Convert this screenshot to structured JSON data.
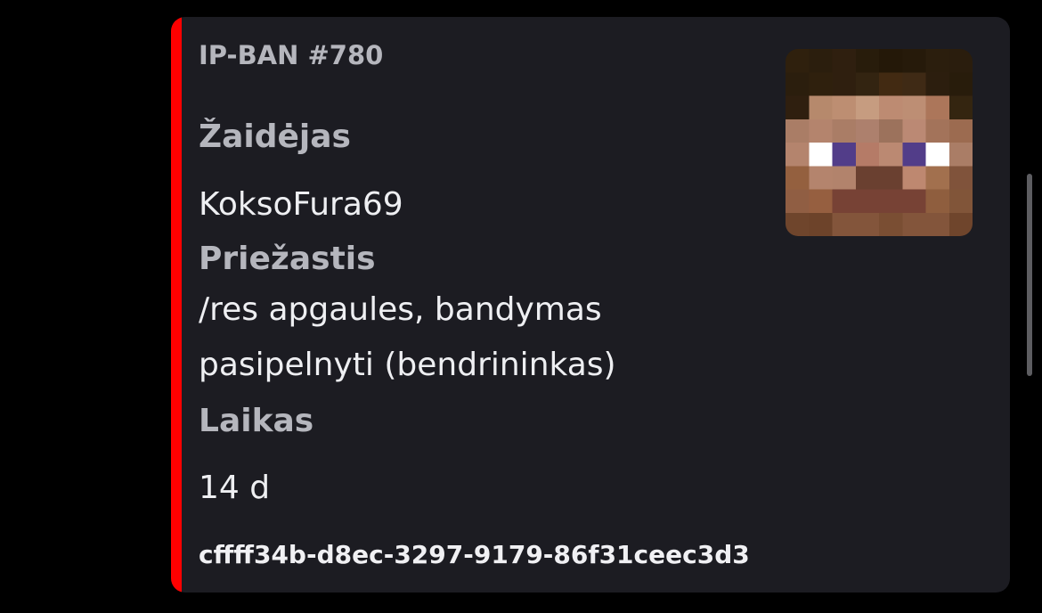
{
  "embed": {
    "accent_color": "#ff0000",
    "author": "IP-BAN #780",
    "fields": [
      {
        "name": "Žaidėjas",
        "value_lines": [
          "KoksoFura69"
        ]
      },
      {
        "name": "Priežastis",
        "value_lines": [
          "/res apgaules, bandymas",
          "pasipelnyti (bendrininkas)"
        ]
      },
      {
        "name": "Laikas",
        "value_lines": [
          "14 d"
        ]
      }
    ],
    "footer": "cffff34b-d8ec-3297-9179-86f31ceec3d3",
    "thumbnail_icon": "minecraft-steve-head-icon"
  }
}
